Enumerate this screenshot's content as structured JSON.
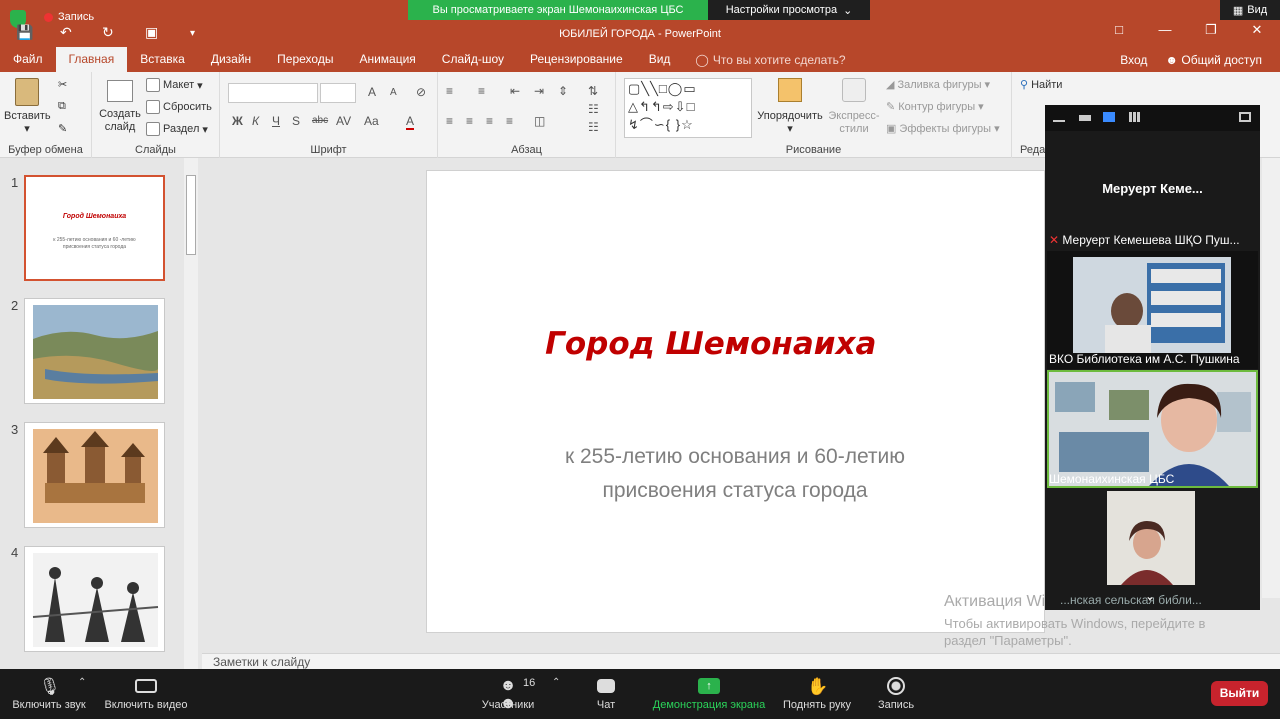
{
  "zoom": {
    "recording_label": "Запись",
    "banner": "Вы просматриваете экран Шемонаихинская ЦБС",
    "view_options": "Настройки просмотра",
    "view_tag": "Вид",
    "participant_count": "16"
  },
  "window": {
    "title": "ЮБИЛЕЙ ГОРОДА - PowerPoint"
  },
  "tabs": [
    "Файл",
    "Главная",
    "Вставка",
    "Дизайн",
    "Переходы",
    "Анимация",
    "Слайд-шоу",
    "Рецензирование",
    "Вид"
  ],
  "tell_me": "Что вы хотите сделать?",
  "tab_right": {
    "login": "Вход",
    "share": "Общий доступ"
  },
  "ribbon": {
    "clipboard": {
      "label": "Буфер обмена",
      "paste": "Вставить"
    },
    "slides": {
      "label": "Слайды",
      "new_slide": "Создать слайд",
      "layout": "Макет",
      "reset": "Сбросить",
      "section": "Раздел"
    },
    "font": {
      "label": "Шрифт",
      "bold": "Ж",
      "italic": "К",
      "underline": "Ч",
      "strike": "abc",
      "spacing": "AV",
      "case": "Aa",
      "color": "A",
      "grow": "A",
      "shrink": "A"
    },
    "paragraph": {
      "label": "Абзац"
    },
    "drawing": {
      "label": "Рисование",
      "arrange": "Упорядочить",
      "styles": "Экспресс-стили",
      "fill": "Заливка фигуры",
      "outline": "Контур фигуры",
      "effects": "Эффекты фигуры"
    },
    "editing": {
      "label": "Реда",
      "find": "Найти"
    }
  },
  "thumbnails": [
    {
      "num": "1",
      "title": "Город Шемонаиха",
      "sub": "к 255-летию основания и 60 -летию присвоения статуса города"
    },
    {
      "num": "2"
    },
    {
      "num": "3"
    },
    {
      "num": "4"
    }
  ],
  "slide": {
    "title": "Город Шемонаиха",
    "subtitle_line1": "к 255-летию основания и 60-летию",
    "subtitle_line2": "присвоения статуса города"
  },
  "notes_placeholder": "Заметки к слайду",
  "activation": {
    "title": "Активация Windows",
    "text": "Чтобы активировать Windows, перейдите в раздел \"Параметры\"."
  },
  "video_panel": {
    "active_speaker": "Меруерт  Кеме...",
    "participants": [
      {
        "name": "Меруерт Кемешева ШҚО Пуш..."
      },
      {
        "name": "ВКО Библиотека им А.С. Пушкина"
      },
      {
        "name": "Шемонаихинская ЦБС"
      },
      {
        "name": "...нская сельская библи..."
      }
    ]
  },
  "bottom_bar": {
    "mute": "Включить звук",
    "video": "Включить видео",
    "participants": "Участники",
    "chat": "Чат",
    "share": "Демонстрация экрана",
    "raise_hand": "Поднять руку",
    "record": "Запись",
    "end": "Выйти"
  }
}
